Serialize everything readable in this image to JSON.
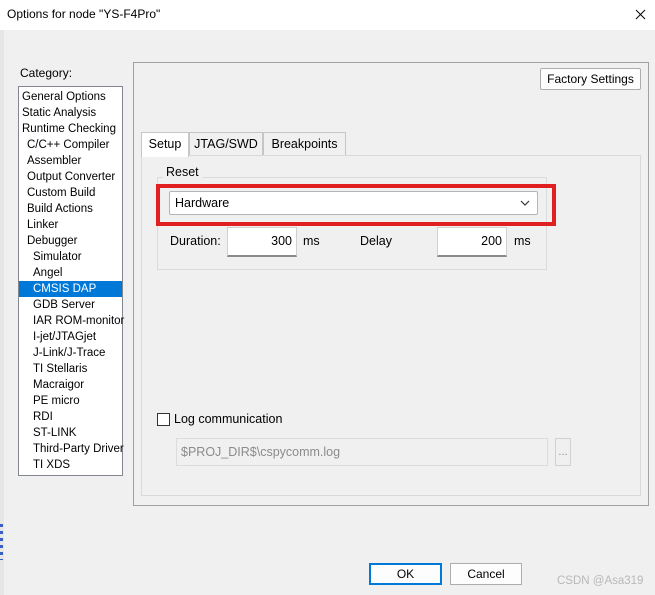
{
  "window": {
    "title": "Options for node \"YS-F4Pro\""
  },
  "category": {
    "label": "Category:",
    "items": [
      {
        "label": "General Options",
        "level": 0
      },
      {
        "label": "Static Analysis",
        "level": 0
      },
      {
        "label": "Runtime Checking",
        "level": 0
      },
      {
        "label": "C/C++ Compiler",
        "level": 1
      },
      {
        "label": "Assembler",
        "level": 1
      },
      {
        "label": "Output Converter",
        "level": 1
      },
      {
        "label": "Custom Build",
        "level": 1
      },
      {
        "label": "Build Actions",
        "level": 1
      },
      {
        "label": "Linker",
        "level": 1
      },
      {
        "label": "Debugger",
        "level": 1
      },
      {
        "label": "Simulator",
        "level": 2
      },
      {
        "label": "Angel",
        "level": 2
      },
      {
        "label": "CMSIS DAP",
        "level": 2,
        "selected": true
      },
      {
        "label": "GDB Server",
        "level": 2
      },
      {
        "label": "IAR ROM-monitor",
        "level": 2
      },
      {
        "label": "I-jet/JTAGjet",
        "level": 2
      },
      {
        "label": "J-Link/J-Trace",
        "level": 2
      },
      {
        "label": "TI Stellaris",
        "level": 2
      },
      {
        "label": "Macraigor",
        "level": 2
      },
      {
        "label": "PE micro",
        "level": 2
      },
      {
        "label": "RDI",
        "level": 2
      },
      {
        "label": "ST-LINK",
        "level": 2
      },
      {
        "label": "Third-Party Driver",
        "level": 2
      },
      {
        "label": "TI XDS",
        "level": 2
      }
    ]
  },
  "factory_settings_label": "Factory Settings",
  "tabs": [
    {
      "label": "Setup",
      "active": true
    },
    {
      "label": "JTAG/SWD",
      "active": false
    },
    {
      "label": "Breakpoints",
      "active": false
    }
  ],
  "reset": {
    "group_label": "Reset",
    "selected": "Hardware",
    "duration_label": "Duration:",
    "duration_value": "300",
    "duration_unit": "ms",
    "delay_label": "Delay",
    "delay_value": "200",
    "delay_unit": "ms"
  },
  "log": {
    "label": "Log communication",
    "checked": false,
    "path": "$PROJ_DIR$\\cspycomm.log",
    "browse_label": "..."
  },
  "buttons": {
    "ok": "OK",
    "cancel": "Cancel"
  },
  "watermark": "CSDN @Asa319",
  "colors": {
    "selection": "#0078d7",
    "highlight": "#e02020"
  }
}
